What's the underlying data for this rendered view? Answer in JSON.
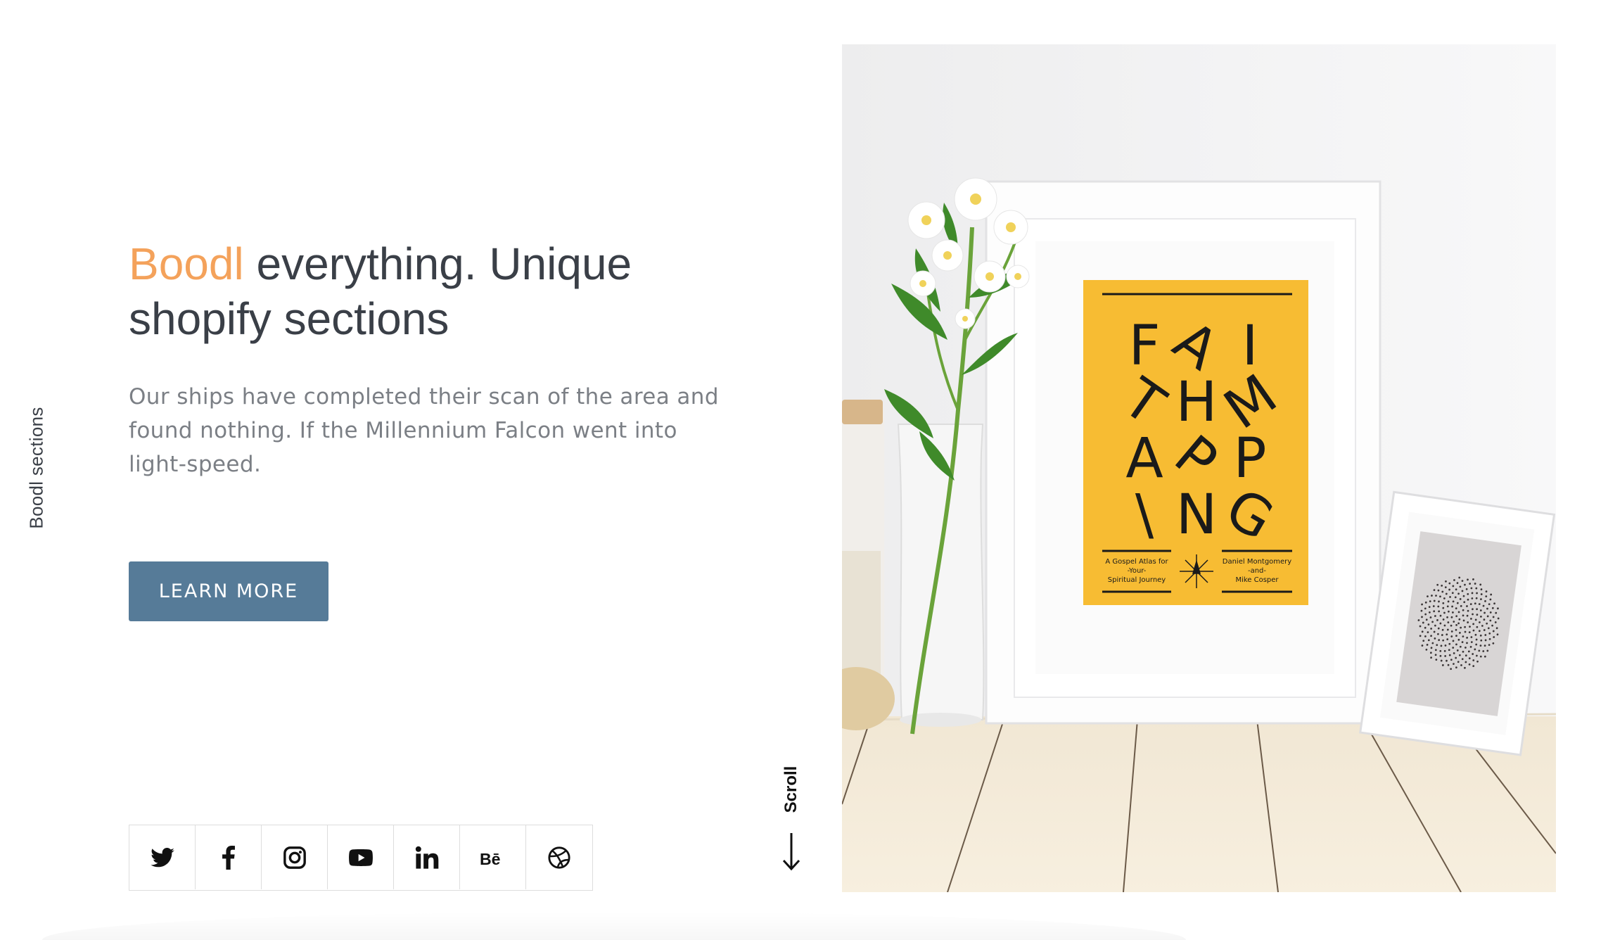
{
  "side_label": "Boodl sections",
  "hero": {
    "title_accent": "Boodl",
    "title_rest": " everything. Unique shopify sections",
    "description": "Our ships have completed their scan of the area and found nothing. If the Millennium Falcon went into light-speed.",
    "cta_label": "LEARN MORE"
  },
  "social": [
    {
      "name": "twitter-icon"
    },
    {
      "name": "facebook-icon"
    },
    {
      "name": "instagram-icon"
    },
    {
      "name": "youtube-icon"
    },
    {
      "name": "linkedin-icon"
    },
    {
      "name": "behance-icon"
    },
    {
      "name": "dribbble-icon"
    }
  ],
  "scroll_label": "Scroll",
  "poster": {
    "rows": [
      [
        "F",
        "A",
        "I"
      ],
      [
        "T",
        "H",
        "M"
      ],
      [
        "A",
        "P",
        "P"
      ],
      [
        "\\",
        "N",
        "G"
      ]
    ],
    "left_caption": [
      "A Gospel Atlas for",
      "-Your-",
      "Spiritual Journey"
    ],
    "right_caption": [
      "Daniel Montgomery",
      "-and-",
      "Mike Cosper"
    ]
  },
  "colors": {
    "accent": "#f4a25b",
    "heading": "#3a3f47",
    "body_text": "#7b7f85",
    "button": "#567b98",
    "poster": "#f7bc33"
  }
}
